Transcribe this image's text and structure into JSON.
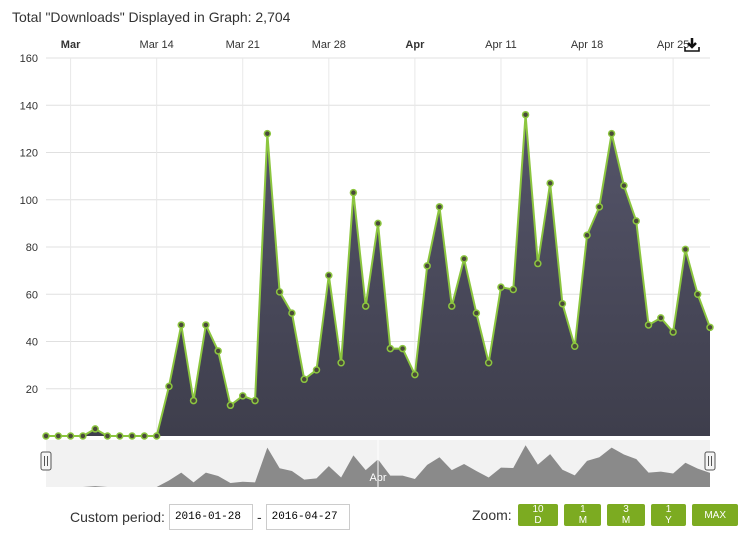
{
  "title": "Total \"Downloads\" Displayed in Graph: 2,704",
  "chart_data": {
    "type": "area",
    "title": "Total \"Downloads\" Displayed in Graph: 2,704",
    "x_start": "2016-03-05",
    "x_end": "2016-04-28",
    "x_ticks": [
      {
        "label": "Mar",
        "date": "2016-03-07",
        "bold": true
      },
      {
        "label": "Mar 14",
        "date": "2016-03-14",
        "bold": false
      },
      {
        "label": "Mar 21",
        "date": "2016-03-21",
        "bold": false
      },
      {
        "label": "Mar 28",
        "date": "2016-03-28",
        "bold": false
      },
      {
        "label": "Apr",
        "date": "2016-04-04",
        "bold": true
      },
      {
        "label": "Apr 11",
        "date": "2016-04-11",
        "bold": false
      },
      {
        "label": "Apr 18",
        "date": "2016-04-18",
        "bold": false
      },
      {
        "label": "Apr 25",
        "date": "2016-04-25",
        "bold": false
      }
    ],
    "y_ticks": [
      20,
      40,
      60,
      80,
      100,
      120,
      140,
      160
    ],
    "ylim": [
      0,
      160
    ],
    "grid": true,
    "values": [
      0,
      0,
      0,
      0,
      3,
      0,
      0,
      0,
      0,
      0,
      21,
      47,
      15,
      47,
      36,
      13,
      17,
      15,
      128,
      61,
      52,
      24,
      28,
      68,
      31,
      103,
      55,
      90,
      37,
      37,
      26,
      72,
      97,
      55,
      75,
      52,
      31,
      63,
      62,
      136,
      73,
      107,
      56,
      38,
      85,
      97,
      128,
      106,
      91,
      47,
      50,
      44,
      79,
      60,
      46
    ],
    "colors": {
      "area": "#4a4a5c",
      "line": "#8cc63f",
      "navigator": "#8a8a8a"
    },
    "navigator_label": "Apr"
  },
  "controls": {
    "custom_period_label": "Custom period:",
    "from": "2016-01-28",
    "separator": "-",
    "to": "2016-04-27",
    "zoom_label": "Zoom:",
    "zoom_buttons": [
      "10 D",
      "1 M",
      "3 M",
      "1 Y",
      "MAX"
    ]
  },
  "icons": {
    "export": "download-icon"
  }
}
